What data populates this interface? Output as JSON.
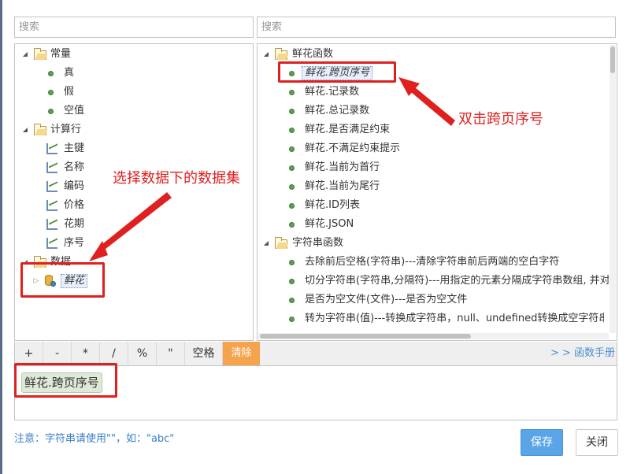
{
  "search": {
    "left_placeholder": "搜索",
    "right_placeholder": "搜索"
  },
  "left_tree": {
    "constants": {
      "label": "常量",
      "items": [
        "真",
        "假",
        "空值"
      ]
    },
    "computed_rows": {
      "label": "计算行",
      "items": [
        "主键",
        "名称",
        "编码",
        "价格",
        "花期",
        "序号"
      ]
    },
    "data": {
      "label": "数据",
      "dataset": "鲜花"
    }
  },
  "right_tree": {
    "flower_functions": {
      "label": "鲜花函数",
      "items": [
        "鲜花.跨页序号",
        "鲜花.记录数",
        "鲜花.总记录数",
        "鲜花.是否满足约束",
        "鲜花.不满足约束提示",
        "鲜花.当前为首行",
        "鲜花.当前为尾行",
        "鲜花.ID列表",
        "鲜花.JSON"
      ]
    },
    "string_functions": {
      "label": "字符串函数",
      "items": [
        "去除前后空格(字符串)---清除字符串前后两端的空白字符",
        "切分字符串(字符串,分隔符)---用指定的元素分隔成字符串数组, 并对:",
        "是否为空文件(文件)---是否为空文件",
        "转为字符串(值)---转换成字符串，null、undefined转换成空字符串"
      ]
    }
  },
  "toolbar": {
    "operators": [
      "+",
      "-",
      "*",
      "/",
      "%",
      "\"",
      "空格"
    ],
    "clear_label": "清除",
    "manual_link": "> > 函数手册"
  },
  "expression": {
    "chip": "鲜花.跨页序号"
  },
  "footer": {
    "note": "注意：字符串请使用\"\"，如：\"abc\"",
    "save_label": "保存",
    "close_label": "关闭"
  },
  "annotations": {
    "double_click": "双击跨页序号",
    "select_dataset": "选择数据下的数据集"
  },
  "colors": {
    "accent": "#5aa4e8",
    "clear": "#f5a34c",
    "annotation": "#e02020",
    "link": "#4a8fd1"
  }
}
